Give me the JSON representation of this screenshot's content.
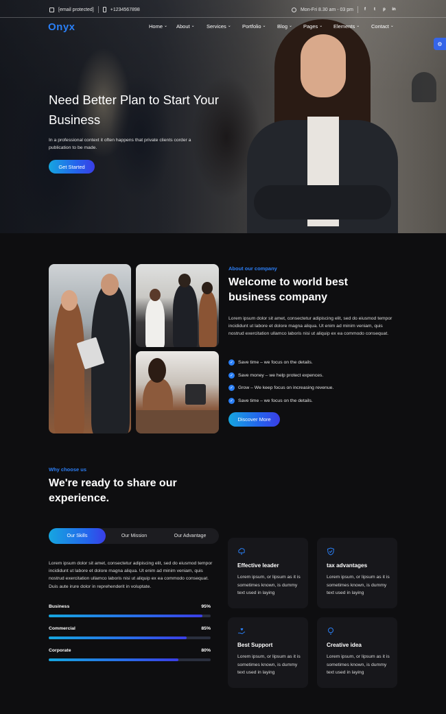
{
  "topbar": {
    "email": "[email protected]",
    "phone": "+1234567898",
    "hours": "Mon-Fri 8.30 am - 03 pm",
    "social": [
      "f",
      "t",
      "p",
      "in"
    ]
  },
  "nav": {
    "logo": "Onyx",
    "items": [
      "Home",
      "About",
      "Services",
      "Portfolio",
      "Blog",
      "Pages",
      "Elements",
      "Contact"
    ]
  },
  "hero": {
    "title": "Need Better Plan to Start Your Business",
    "subtitle": "In a professional context it often happens that private clients corder a publication to be made.",
    "button": "Get Started"
  },
  "about": {
    "eyebrow": "About our company",
    "heading": "Welcome to world best business company",
    "paragraph": "Lorem ipsum dolor sit amet, consectetur adipiscing elit, sed do eiusmod tempor incididunt ut labore et dolore magna aliqua. Ut enim ad minim veniam, quis nostrud exercitation ullamco laboris nisi ut aliquip ex ea commodo consequat.",
    "checks": [
      "Save time – we focus on the details.",
      "Save money – we help protect expences.",
      "Grow – We keep focus on increasing revenue.",
      "Save time – we focus on the details."
    ],
    "button": "Discover More"
  },
  "why": {
    "eyebrow": "Why choose us",
    "heading": "We're ready to share our experience.",
    "tabs": [
      "Our Skills",
      "Our Mission",
      "Our Advantage"
    ],
    "paragraph": "Lorem ipsum dolor sit amet, consectetur adipiscing elit, sed do eiusmod tempor incididunt ut labore et dolore magna aliqua. Ut enim ad minim veniam, quis nostrud exercitation ullamco laboris nisi ut aliquip ex ea commodo consequat. Duis aute irure dolor in reprehenderit in voluptate.",
    "skills": [
      {
        "name": "Business",
        "value": "95%",
        "level": 0.95
      },
      {
        "name": "Commercial",
        "value": "85%",
        "level": 0.85
      },
      {
        "name": "Corporate",
        "value": "80%",
        "level": 0.8
      }
    ],
    "cards": [
      {
        "title": "Effective leader",
        "text": "Lorem ipsum, or lipsum as it is sometimes known, is dummy text used in laying",
        "icon": "bulb-cloud-icon"
      },
      {
        "title": "tax advantages",
        "text": "Lorem ipsum, or lipsum as it is sometimes known, is dummy text used in laying",
        "icon": "shield-icon"
      },
      {
        "title": "Best Support",
        "text": "Lorem ipsum, or lipsum as it is sometimes known, is dummy text used in laying",
        "icon": "hand-heart-icon"
      },
      {
        "title": "Creative idea",
        "text": "Lorem ipsum, or lipsum as it is sometimes known, is dummy text used in laying",
        "icon": "bulb-icon"
      }
    ]
  },
  "colors": {
    "accent": "#2a7ff5",
    "gradient_start": "#16a6e0",
    "gradient_end": "#3a3ee6",
    "background": "#0e0e10",
    "card": "#17171b"
  }
}
